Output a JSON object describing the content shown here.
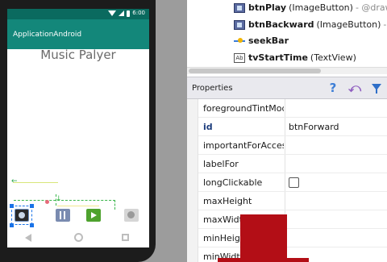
{
  "device": {
    "status_time": "6:00",
    "app_title": "ApplicationAndroid",
    "heading": "Music Palyer"
  },
  "component_tree": {
    "items": [
      {
        "name": "btnPlay",
        "type": "(ImageButton)",
        "ref": "- @drawa",
        "icon": "image-button-icon"
      },
      {
        "name": "btnBackward",
        "type": "(ImageButton)",
        "ref": "- @",
        "icon": "image-button-icon"
      },
      {
        "name": "seekBar",
        "type": "",
        "ref": "",
        "icon": "seekbar-icon"
      },
      {
        "name": "tvStartTime",
        "type": "(TextView)",
        "ref": "",
        "icon": "textview-icon"
      }
    ]
  },
  "properties": {
    "title": "Properties",
    "rows": [
      {
        "name": "foregroundTintMod",
        "value": ""
      },
      {
        "name": "id",
        "value": "btnForward",
        "bold": true
      },
      {
        "name": "importantForAccess",
        "value": ""
      },
      {
        "name": "labelFor",
        "value": ""
      },
      {
        "name": "longClickable",
        "value": "",
        "checkbox": true,
        "checked": false
      },
      {
        "name": "maxHeight",
        "value": ""
      },
      {
        "name": "maxWidth",
        "value": ""
      },
      {
        "name": "minHeight",
        "value": ""
      },
      {
        "name": "minWidth",
        "value": ""
      }
    ]
  },
  "colors": {
    "action_bar": "#13877a",
    "status_bar": "#0a6a5f",
    "accent_red": "#b30e16"
  }
}
